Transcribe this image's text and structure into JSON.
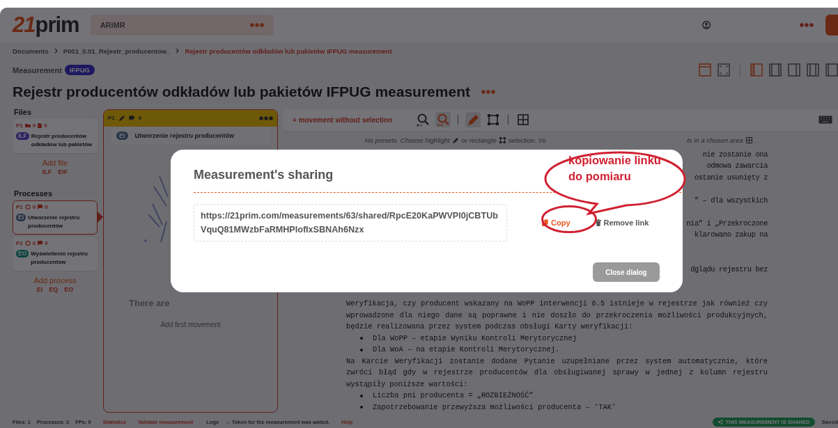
{
  "header": {
    "logo_mark": "21",
    "logo_text": "prim",
    "organization": "ARiMR"
  },
  "breadcrumbs": [
    {
      "label": "Documents",
      "current": false
    },
    {
      "label": "P001_0.01_Rejestr_producentow_",
      "current": false
    },
    {
      "label": "Rejestr producentów odkładów lub pakietów IFPUG measurement",
      "current": true
    }
  ],
  "measurement": {
    "label": "Measurement",
    "method": "IFPUG",
    "title": "Rejestr producentów odkładów lub pakietów IFPUG measurement"
  },
  "view_buttons": [
    {
      "kind": "window",
      "selected": true
    },
    {
      "kind": "fullscreen",
      "selected": false
    }
  ],
  "column_buttons": [
    {
      "selected": true
    },
    {
      "selected": false
    },
    {
      "selected": false
    },
    {
      "selected": false
    },
    {
      "selected": false
    }
  ],
  "sidebar": {
    "files_heading": "Files",
    "files": [
      {
        "number": "P1",
        "folders": "0",
        "documents": "0",
        "type": "ILF",
        "name": "Rejestr producentów odkładów lub pakietów",
        "selected": false
      }
    ],
    "add_file": "Add file",
    "file_types": [
      "ILF",
      "EIF"
    ],
    "processes_heading": "Processes",
    "processes": [
      {
        "number": "P1",
        "movements": "0",
        "comments": "0",
        "type": "EI",
        "name": "Utworzenie rejestru producentów",
        "selected": true
      },
      {
        "number": "P2",
        "movements": "0",
        "comments": "0",
        "type": "EO",
        "name": "Wyświetlenie rejestru producentów",
        "selected": false
      }
    ],
    "add_process": "Add process",
    "process_types": [
      "EI",
      "EQ",
      "EO"
    ]
  },
  "process_column": {
    "number": "P1",
    "comments": "0",
    "row_type": "EI",
    "row_name": "Utworzenie rejestru producentów",
    "empty_text": "There are",
    "add_first": "Add first movement"
  },
  "document": {
    "add_movement": "+ movement without selection",
    "tools": [
      {
        "kind": "zoom",
        "selected": false
      },
      {
        "kind": "zoom-fit",
        "selected": true
      },
      {
        "kind": "pencil",
        "selected": true
      },
      {
        "kind": "rectangle",
        "selected": false
      },
      {
        "kind": "grid",
        "selected": false
      }
    ],
    "hint": {
      "before": "No presets. Choose highlight",
      "middle": "or rectangle",
      "after": "selection. Yo",
      "end": "ts in a chosen area",
      "tail": "."
    },
    "fragments": [
      [
        "nie zostanie ona",
        "odmowa zawarcia",
        "ostanie usunięty z"
      ],
      [
        "” – dla wszystkich"
      ],
      [
        "nia” i „Przekroczone",
        "klarowano zakup na"
      ],
      [
        "dglądu rejestru bez"
      ]
    ],
    "blocks": [
      {
        "kind": "paragraph",
        "text": "Weryfikacja, czy producent wskazany na WoPP interwencji 6.5 istnieje w rejestrze jak również czy wprowadzone dla niego dane są poprawne i nie doszło do przekroczenia możliwości produkcyjnych, będzie realizowana przez system podczas obsługi Karty weryfikacji:"
      },
      {
        "kind": "bullet",
        "text": "Dla WoPP – etapie Wyniku Kontroli Merytorycznej"
      },
      {
        "kind": "bullet",
        "text": "Dla WoA – na etapie Kontroli Merytorycznej."
      },
      {
        "kind": "paragraph",
        "text": "Na Karcie Weryfikacji zostanie dodane Pytanie uzupełniane przez system automatycznie, które zwróci błąd gdy w rejestrze producentów dla obsługiwanej sprawy w jednej z kolumn rejestru wystąpiły poniższe wartości:"
      },
      {
        "kind": "bullet",
        "text": "Liczba pni producenta = „ROZBIEŻNOŚĆ”"
      },
      {
        "kind": "bullet",
        "text": "Zapotrzebowanie przewyższa możliwości producenta – 'TAK'"
      }
    ]
  },
  "status_bar": {
    "counts": [
      "Files: 1",
      "Processes: 2",
      "FPs: 0"
    ],
    "links": [
      "Statistics",
      "Validate measurement"
    ],
    "logs": "Logs",
    "log_message": "→ Token for the measurement was added.",
    "help": "Help",
    "shared_badge": "THIS MEASUREMENT IS SHARED",
    "save_state": "Saved"
  },
  "dialog": {
    "title": "Measurement's sharing",
    "link": "https://21prim.com/measurements/63/shared/RpcE20KaPWVPl0jCBTUbVquQ81MWzbFaRMHPlofIxSBNAh6Nzx",
    "copy": "Copy",
    "remove": "Remove link",
    "close": "Close dialog"
  },
  "callout": {
    "text": "kopiowanie linku do pomiaru"
  }
}
